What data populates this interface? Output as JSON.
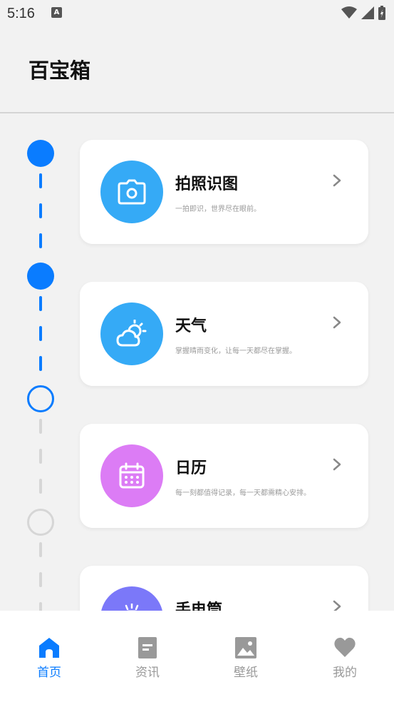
{
  "status_bar": {
    "time": "5:16",
    "notification_glyph": "A"
  },
  "header": {
    "title": "百宝箱"
  },
  "cards": [
    {
      "title": "拍照识图",
      "desc": "一拍即识，世界尽在眼前。",
      "icon": "camera-icon",
      "color": "#35aaf6"
    },
    {
      "title": "天气",
      "desc": "掌握晴雨变化，让每一天都尽在掌握。",
      "icon": "weather-icon",
      "color": "#35aaf6"
    },
    {
      "title": "日历",
      "desc": "每一刻都值得记录，每一天都需精心安排。",
      "icon": "calendar-icon",
      "color": "#dc7cf5"
    },
    {
      "title": "手电筒",
      "desc": "",
      "icon": "flashlight-icon",
      "color": "#7b78f9"
    }
  ],
  "timeline": {
    "accent": "#0a7cff",
    "inactive": "#d6d6d6"
  },
  "bottom_nav": {
    "items": [
      {
        "label": "首页",
        "icon": "home-icon",
        "active": true
      },
      {
        "label": "资讯",
        "icon": "news-icon",
        "active": false
      },
      {
        "label": "壁纸",
        "icon": "wallpaper-icon",
        "active": false
      },
      {
        "label": "我的",
        "icon": "heart-icon",
        "active": false
      }
    ]
  }
}
